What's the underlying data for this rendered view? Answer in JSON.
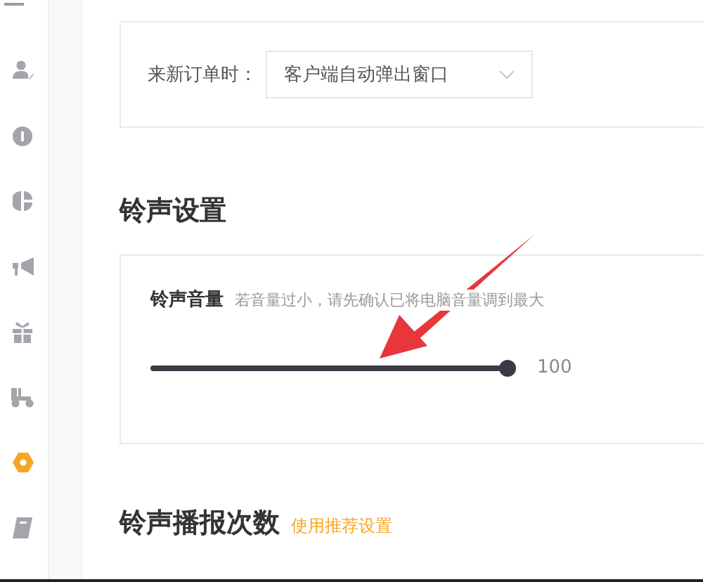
{
  "sidebar": {
    "items": [
      {
        "selected": false
      },
      {
        "selected": false
      },
      {
        "selected": false
      },
      {
        "selected": false
      },
      {
        "selected": false
      },
      {
        "selected": false
      },
      {
        "selected": true
      },
      {
        "selected": false
      }
    ]
  },
  "order_popup": {
    "label": "来新订单时：",
    "select": {
      "value": "客户端自动弹出窗口"
    }
  },
  "ringtone_settings": {
    "title": "铃声设置",
    "volume": {
      "label": "铃声音量",
      "hint": "若音量过小，请先确认已将电脑音量调到最大",
      "level": 1,
      "reading": "100"
    }
  },
  "ringtone_count": {
    "title": "铃声播报次数",
    "link": "使用推荐设置"
  }
}
